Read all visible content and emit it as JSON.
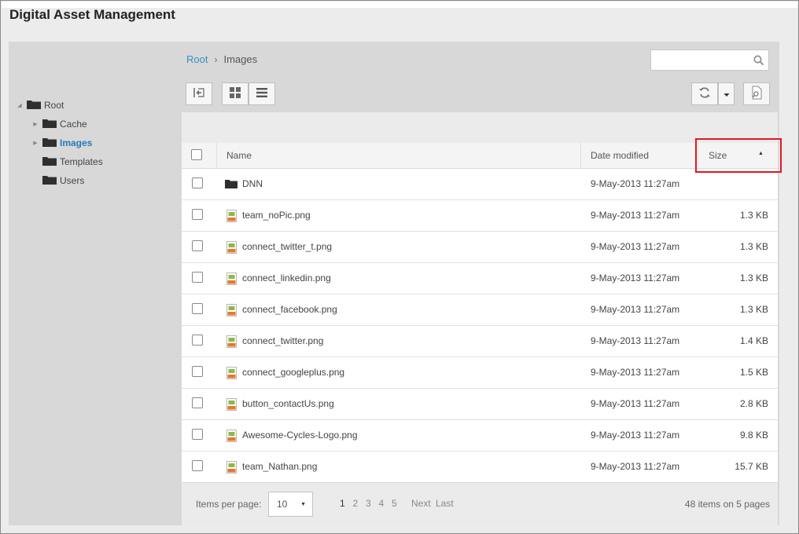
{
  "app": {
    "title": "Digital Asset Management"
  },
  "tree": {
    "items": [
      {
        "label": "Root",
        "expandable": true,
        "expanded": true,
        "selected": false
      },
      {
        "label": "Cache",
        "expandable": true,
        "expanded": false,
        "selected": false
      },
      {
        "label": "Images",
        "expandable": true,
        "expanded": false,
        "selected": true
      },
      {
        "label": "Templates",
        "expandable": false,
        "expanded": false,
        "selected": false
      },
      {
        "label": "Users",
        "expandable": false,
        "expanded": false,
        "selected": false
      }
    ]
  },
  "breadcrumb": {
    "root": "Root",
    "separator": "›",
    "current": "Images"
  },
  "search": {
    "value": "",
    "placeholder": ""
  },
  "list": {
    "columns": {
      "name": "Name",
      "date": "Date modified",
      "size": "Size",
      "sort_indicator": "▲"
    },
    "rows": [
      {
        "type": "folder",
        "name": "DNN",
        "date": "9-May-2013 11:27am",
        "size": ""
      },
      {
        "type": "png",
        "name": "team_noPic.png",
        "date": "9-May-2013 11:27am",
        "size": "1.3 KB"
      },
      {
        "type": "png",
        "name": "connect_twitter_t.png",
        "date": "9-May-2013 11:27am",
        "size": "1.3 KB"
      },
      {
        "type": "png",
        "name": "connect_linkedin.png",
        "date": "9-May-2013 11:27am",
        "size": "1.3 KB"
      },
      {
        "type": "png",
        "name": "connect_facebook.png",
        "date": "9-May-2013 11:27am",
        "size": "1.3 KB"
      },
      {
        "type": "png",
        "name": "connect_twitter.png",
        "date": "9-May-2013 11:27am",
        "size": "1.4 KB"
      },
      {
        "type": "png",
        "name": "connect_googleplus.png",
        "date": "9-May-2013 11:27am",
        "size": "1.5 KB"
      },
      {
        "type": "png",
        "name": "button_contactUs.png",
        "date": "9-May-2013 11:27am",
        "size": "2.8 KB"
      },
      {
        "type": "png",
        "name": "Awesome-Cycles-Logo.png",
        "date": "9-May-2013 11:27am",
        "size": "9.8 KB"
      },
      {
        "type": "png",
        "name": "team_Nathan.png",
        "date": "9-May-2013 11:27am",
        "size": "15.7 KB"
      }
    ]
  },
  "pager": {
    "items_per_page_label": "Items per page:",
    "items_per_page_value": "10",
    "pages": [
      "1",
      "2",
      "3",
      "4",
      "5"
    ],
    "current_page": "1",
    "next_label": "Next",
    "last_label": "Last",
    "summary": "48 items on 5 pages"
  },
  "colors": {
    "accent": "#3a8fc0",
    "selected_tree": "#2a7ab8",
    "highlight_box": "#e0191f"
  },
  "icons": {
    "toolbar": [
      "collapse-panel-icon",
      "grid-view-icon",
      "list-view-icon",
      "refresh-icon",
      "dropdown-caret-icon",
      "file-search-icon"
    ],
    "search": "search-icon",
    "folder": "folder-icon",
    "file": "png-file-icon"
  }
}
